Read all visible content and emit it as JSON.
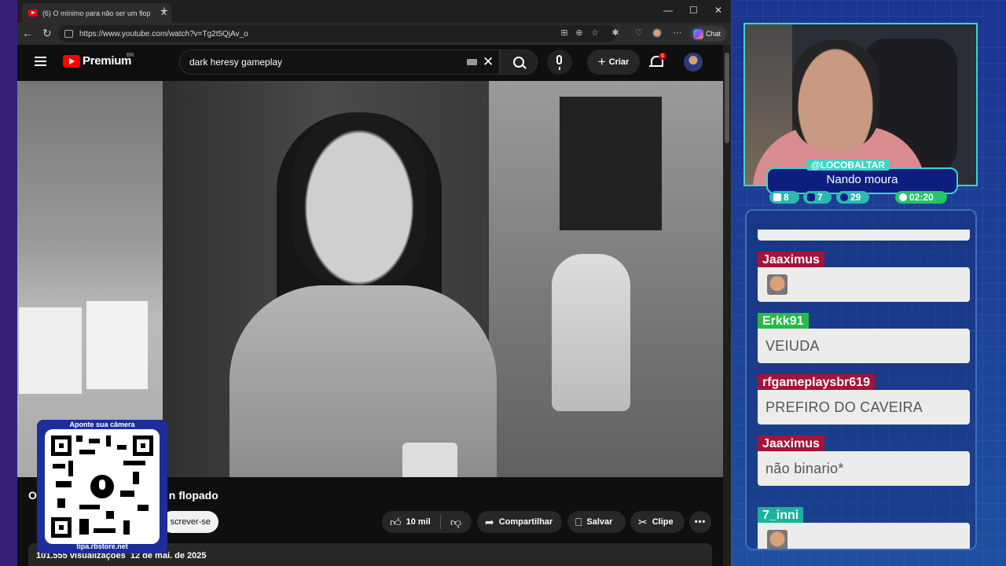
{
  "browser": {
    "tab_title": "(6) O mínimo para não ser um flop",
    "url": "https://www.youtube.com/watch?v=Tg2t5QjAv_o",
    "chat_label": "Chat"
  },
  "youtube": {
    "logo_text": "Premium",
    "country_code": "BR",
    "search_query": "dark heresy gameplay",
    "create_label": "Criar",
    "notification_count": "6",
    "video_title_start": "O",
    "video_title_end": "n flopado",
    "subscribe_label": "screver-se",
    "likes": "10 mil",
    "share_label": "Compartilhar",
    "save_label": "Salvar",
    "clip_label": "Clipe",
    "more_label": "•••",
    "views": "101.555 visualizações",
    "date": "12 de mai. de 2025"
  },
  "qr": {
    "caption": "Aponte sua câmera",
    "url": "tipa.rbstore.net"
  },
  "streamer": {
    "handle": "@LOCOBALTAR",
    "name": "Nando moura",
    "stats": {
      "twitch": "8",
      "youtube": "7",
      "kick": "29",
      "time": "02:20"
    }
  },
  "chat": {
    "messages": [
      {
        "user": "Jaaximus",
        "text": ""
      },
      {
        "user": "Erkk91",
        "text": "VEIUDA"
      },
      {
        "user": "rfgameplaysbr619",
        "text": "PREFIRO DO CAVEIRA"
      },
      {
        "user": "Jaaximus",
        "text": "não binario*"
      },
      {
        "user": "7_inni",
        "text": ""
      }
    ]
  },
  "colors": {
    "accent_teal": "#39d6c7",
    "user_red": "#a3133a",
    "user_green": "#27b94a",
    "yt_red": "#ff0000"
  }
}
